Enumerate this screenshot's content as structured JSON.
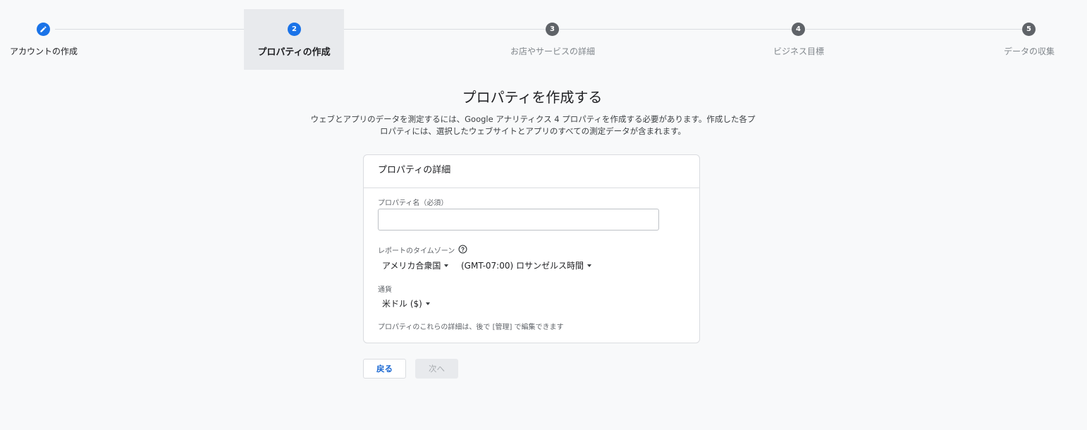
{
  "stepper": {
    "steps": [
      {
        "number": "",
        "label": "アカウントの作成",
        "state": "done",
        "icon": "pencil-icon"
      },
      {
        "number": "2",
        "label": "プロパティの作成",
        "state": "active"
      },
      {
        "number": "3",
        "label": "お店やサービスの詳細",
        "state": "pending"
      },
      {
        "number": "4",
        "label": "ビジネス目標",
        "state": "pending"
      },
      {
        "number": "5",
        "label": "データの収集",
        "state": "pending"
      }
    ]
  },
  "page": {
    "title": "プロパティを作成する",
    "description": "ウェブとアプリのデータを測定するには、Google アナリティクス 4 プロパティを作成する必要があります。作成した各プロパティには、選択したウェブサイトとアプリのすべての測定データが含まれます。"
  },
  "card": {
    "header": "プロパティの詳細",
    "property_name_label": "プロパティ名（必須）",
    "property_name_value": "",
    "timezone_label": "レポートのタイムゾーン",
    "timezone_help_icon": "help-circle-icon",
    "country_value": "アメリカ合衆国",
    "timezone_value": "(GMT-07:00) ロサンゼルス時間",
    "currency_label": "通貨",
    "currency_value": "米ドル ($)",
    "note": "プロパティのこれらの詳細は、後で [管理] で編集できます"
  },
  "buttons": {
    "back_label": "戻る",
    "next_label": "次へ"
  },
  "colors": {
    "accent": "#1a73e8",
    "step_pending": "#5f6368",
    "background": "#f8f9fa"
  }
}
